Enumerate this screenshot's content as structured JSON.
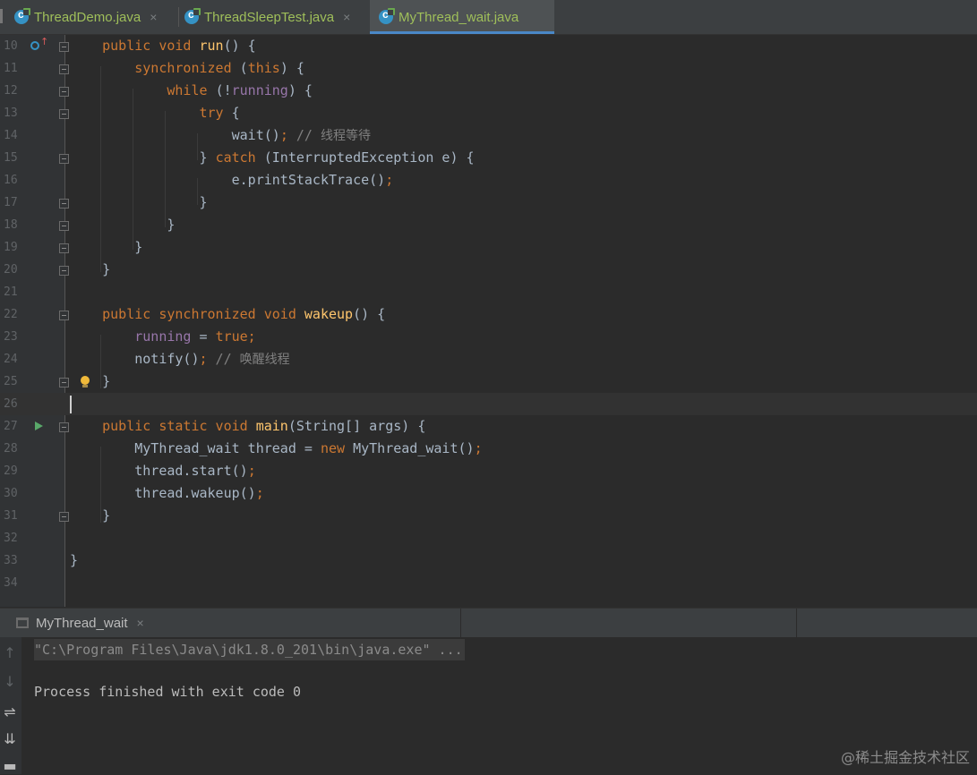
{
  "tabs": [
    {
      "label": "ThreadDemo.java",
      "close": "×",
      "active": false
    },
    {
      "label": "ThreadSleepTest.java",
      "close": "×",
      "active": false
    },
    {
      "label": "MyThread_wait.java",
      "close": "",
      "active": true
    }
  ],
  "lines": [
    {
      "n": "10",
      "tokens": [
        [
          "",
          "    "
        ],
        [
          "kw",
          "public void "
        ],
        [
          "fn",
          "run"
        ],
        [
          "",
          "() {"
        ]
      ]
    },
    {
      "n": "11",
      "tokens": [
        [
          "",
          "        "
        ],
        [
          "kw",
          "synchronized "
        ],
        [
          "",
          "("
        ],
        [
          "kw",
          "this"
        ],
        [
          "",
          ") {"
        ]
      ]
    },
    {
      "n": "12",
      "tokens": [
        [
          "",
          "            "
        ],
        [
          "kw",
          "while "
        ],
        [
          "",
          "(!"
        ],
        [
          "fld",
          "running"
        ],
        [
          "",
          ") {"
        ]
      ]
    },
    {
      "n": "13",
      "tokens": [
        [
          "",
          "                "
        ],
        [
          "kw",
          "try "
        ],
        [
          "",
          "{"
        ]
      ]
    },
    {
      "n": "14",
      "tokens": [
        [
          "",
          "                    wait()"
        ],
        [
          "kw",
          ";"
        ],
        [
          "cm",
          " // "
        ],
        [
          "cm cn",
          "线程等待"
        ]
      ]
    },
    {
      "n": "15",
      "tokens": [
        [
          "",
          "                } "
        ],
        [
          "kw",
          "catch "
        ],
        [
          "",
          "(InterruptedException e) {"
        ]
      ]
    },
    {
      "n": "16",
      "tokens": [
        [
          "",
          "                    e.printStackTrace()"
        ],
        [
          "kw",
          ";"
        ]
      ]
    },
    {
      "n": "17",
      "tokens": [
        [
          "",
          "                }"
        ]
      ]
    },
    {
      "n": "18",
      "tokens": [
        [
          "",
          "            }"
        ]
      ]
    },
    {
      "n": "19",
      "tokens": [
        [
          "",
          "        }"
        ]
      ]
    },
    {
      "n": "20",
      "tokens": [
        [
          "",
          "    }"
        ]
      ]
    },
    {
      "n": "21",
      "tokens": []
    },
    {
      "n": "22",
      "tokens": [
        [
          "",
          "    "
        ],
        [
          "kw",
          "public synchronized void "
        ],
        [
          "fn",
          "wakeup"
        ],
        [
          "",
          "() {"
        ]
      ]
    },
    {
      "n": "23",
      "tokens": [
        [
          "",
          "        "
        ],
        [
          "fld",
          "running "
        ],
        [
          "",
          "= "
        ],
        [
          "kw",
          "true;"
        ]
      ]
    },
    {
      "n": "24",
      "tokens": [
        [
          "",
          "        notify()"
        ],
        [
          "kw",
          ";"
        ],
        [
          "cm",
          " // "
        ],
        [
          "cm cn",
          "唤醒线程"
        ]
      ]
    },
    {
      "n": "25",
      "tokens": [
        [
          "",
          "    }"
        ]
      ]
    },
    {
      "n": "26",
      "tokens": []
    },
    {
      "n": "27",
      "tokens": [
        [
          "",
          "    "
        ],
        [
          "kw",
          "public static void "
        ],
        [
          "fn",
          "main"
        ],
        [
          "",
          "(String[] args) {"
        ]
      ]
    },
    {
      "n": "28",
      "tokens": [
        [
          "",
          "        MyThread_wait thread = "
        ],
        [
          "kw",
          "new "
        ],
        [
          "",
          "MyThread_wait()"
        ],
        [
          "kw",
          ";"
        ]
      ]
    },
    {
      "n": "29",
      "tokens": [
        [
          "",
          "        thread.start()"
        ],
        [
          "kw",
          ";"
        ]
      ]
    },
    {
      "n": "30",
      "tokens": [
        [
          "",
          "        thread.wakeup()"
        ],
        [
          "kw",
          ";"
        ]
      ]
    },
    {
      "n": "31",
      "tokens": [
        [
          "",
          "    }"
        ]
      ]
    },
    {
      "n": "32",
      "tokens": []
    },
    {
      "n": "33",
      "tokens": [
        [
          "",
          "}"
        ]
      ]
    },
    {
      "n": "34",
      "tokens": []
    }
  ],
  "run": {
    "tab_label": "MyThread_wait",
    "tab_close": "×",
    "command": "\"C:\\Program Files\\Java\\jdk1.8.0_201\\bin\\java.exe\" ...",
    "output": "Process finished with exit code 0"
  },
  "icons": {
    "tab_file": "java-class-icon",
    "gutter_override": "override-method-icon",
    "gutter_run": "run-arrow-icon",
    "intention": "lightbulb-icon",
    "console_up": "arrow-up-icon",
    "console_down": "arrow-down-icon",
    "console_wrap": "soft-wrap-icon",
    "console_scroll": "scroll-to-end-icon"
  },
  "colors": {
    "keyword": "#cc7832",
    "method": "#ffc66d",
    "field": "#9876aa",
    "comment": "#808080",
    "text": "#a9b7c6",
    "tab_underline": "#4a88c7",
    "tab_text": "#9fbf5a"
  },
  "watermark": "@稀土掘金技术社区"
}
